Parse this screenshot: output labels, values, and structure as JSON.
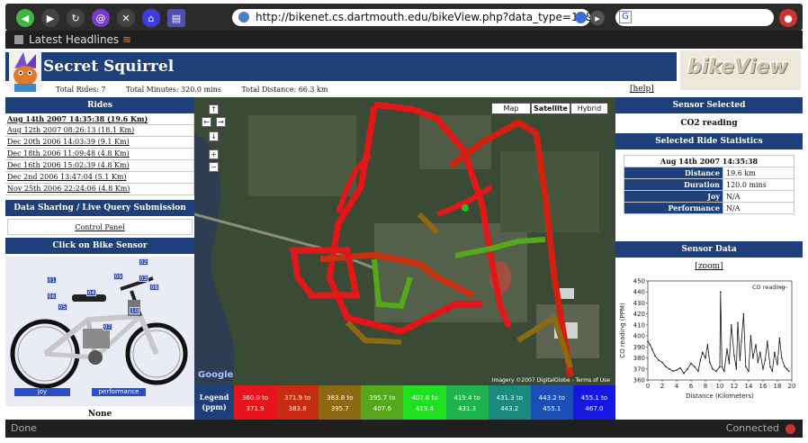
{
  "browser": {
    "url": "http://bikenet.cs.dartmouth.edu/bikeView.php?data_type=11&",
    "bookmark_label": "Latest Headlines",
    "status_left": "Done",
    "status_right": "Connected"
  },
  "header": {
    "site_title": "Secret Squirrel",
    "logo_text": "bikeView",
    "total_rides": "Total Rides: 7",
    "total_minutes": "Total Minutes: 320.0 mins",
    "total_distance": "Total Distance: 66.3 km",
    "help": "[help]"
  },
  "rides": {
    "heading": "Rides",
    "items": [
      "Aug 14th 2007 14:35:38 (19.6 Km)",
      "Aug 12th 2007 08:26:13 (18.1 Km)",
      "Dec 20th 2006 14:03:39 (9.1 Km)",
      "Dec 18th 2006 11:09:48 (4.8 Km)",
      "Dec 16th 2006 15:02:39 (4.8 Km)",
      "Dec 2nd 2006 13:47:04 (5.1 Km)",
      "Nov 25th 2006 22:24:06 (4.8 Km)"
    ]
  },
  "sharing": {
    "heading": "Data Sharing / Live Query Submission",
    "control_panel": "Control Panel"
  },
  "bike": {
    "heading": "Click on Bike Sensor",
    "btn_joy": "joy",
    "btn_performance": "performance",
    "none_label": "None",
    "tags": [
      "02",
      "03",
      "09",
      "08",
      "01",
      "06",
      "05",
      "04",
      "07",
      "10"
    ]
  },
  "map": {
    "btn_map": "Map",
    "btn_satellite": "Satellite",
    "btn_hybrid": "Hybrid",
    "credit": "Imagery ©2007 DigitalGlobe - Terms of Use",
    "powered": "Google"
  },
  "legend": {
    "label_line1": "Legend",
    "label_line2": "(ppm)",
    "cells": [
      {
        "text": "360.0 to 371.9",
        "color": "#e8141c"
      },
      {
        "text": "371.9 to 383.8",
        "color": "#c82c10"
      },
      {
        "text": "383.8 to 395.7",
        "color": "#8d6a12"
      },
      {
        "text": "395.7 to 407.6",
        "color": "#54a81a"
      },
      {
        "text": "407.6 to 419.4",
        "color": "#20e020"
      },
      {
        "text": "419.4 to 431.3",
        "color": "#1fb34e"
      },
      {
        "text": "431.3 to 443.2",
        "color": "#1a8a7e"
      },
      {
        "text": "443.2 to 455.1",
        "color": "#1a4fb8"
      },
      {
        "text": "455.1 to 467.0",
        "color": "#1618e0"
      }
    ]
  },
  "sensor": {
    "heading": "Sensor Selected",
    "name": "CO2 reading"
  },
  "ride_stats": {
    "heading": "Selected Ride Statistics",
    "caption": "Aug 14th 2007 14:35:38",
    "rows": [
      {
        "k": "Distance",
        "v": "19.6 km"
      },
      {
        "k": "Duration",
        "v": "120.0 mins"
      },
      {
        "k": "Joy",
        "v": "N/A"
      },
      {
        "k": "Performance",
        "v": "N/A"
      }
    ]
  },
  "sensor_data": {
    "heading": "Sensor Data",
    "zoom": "[zoom]"
  },
  "chart_data": {
    "type": "line",
    "xlabel": "Distance (Kilometers)",
    "ylabel": "CO reading (PPM)",
    "xlim": [
      0,
      20
    ],
    "ylim": [
      360,
      450
    ],
    "xticks": [
      0,
      2,
      4,
      6,
      8,
      10,
      12,
      14,
      16,
      18,
      20
    ],
    "yticks": [
      360,
      370,
      380,
      390,
      400,
      410,
      420,
      430,
      440,
      450
    ],
    "grid": false,
    "legend_position": "top-right",
    "series": [
      {
        "name": "CO reading",
        "x": [
          0,
          0.3,
          0.6,
          1,
          1.5,
          2,
          2.5,
          3,
          3.5,
          4,
          4.5,
          5,
          5.5,
          6,
          6.5,
          7,
          7.3,
          7.6,
          8,
          8.3,
          8.6,
          9,
          9.5,
          10,
          10.1,
          10.3,
          10.6,
          11,
          11.3,
          11.6,
          12,
          12.3,
          12.5,
          12.8,
          13,
          13.3,
          13.6,
          14,
          14.3,
          14.6,
          15,
          15.3,
          15.6,
          16,
          16.3,
          16.6,
          17,
          17.3,
          17.6,
          18,
          18.3,
          18.6,
          19,
          19.3,
          19.6
        ],
        "y": [
          395,
          392,
          388,
          382,
          378,
          376,
          372,
          370,
          368,
          369,
          371,
          366,
          370,
          375,
          372,
          368,
          378,
          385,
          380,
          392,
          376,
          370,
          368,
          372,
          440,
          372,
          368,
          388,
          375,
          410,
          382,
          370,
          412,
          378,
          395,
          420,
          372,
          368,
          400,
          380,
          392,
          376,
          385,
          370,
          378,
          395,
          372,
          368,
          385,
          374,
          398,
          380,
          372,
          370,
          368
        ]
      }
    ]
  }
}
